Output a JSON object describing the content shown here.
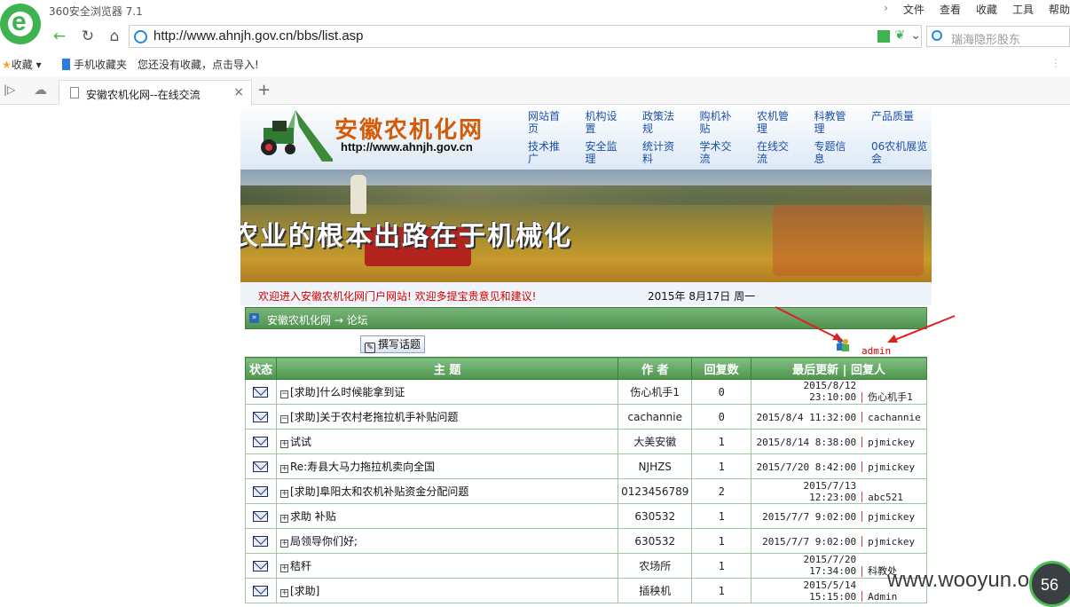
{
  "browser": {
    "app_title": "360安全浏览器 7.1",
    "menus": [
      "文件",
      "查看",
      "收藏",
      "工具",
      "帮助"
    ],
    "url": "http://www.ahnjh.gov.cn/bbs/list.asp",
    "search_placeholder": "瑞海隐形股东",
    "bookmarks": {
      "favorites": "收藏",
      "mobile_favorites": "手机收藏夹",
      "import_hint": "您还没有收藏，点击导入!"
    },
    "tab_title": "安徽农机化网--在线交流"
  },
  "site": {
    "name": "安徽农机化网",
    "url": "http://www.ahnjh.gov.cn",
    "nav": [
      "网站首页",
      "机构设置",
      "政策法规",
      "购机补贴",
      "农机管理",
      "科教管理",
      "产品质量",
      "技术推广",
      "安全监理",
      "统计资料",
      "学术交流",
      "在线交流",
      "专题信息",
      "06农机展览会"
    ],
    "slogan": "农业的根本出路在于机械化",
    "welcome": "欢迎进入安徽农机化网门户网站! 欢迎多提宝贵意见和建议!",
    "date": "2015年  8月17日  周一",
    "breadcrumb": "安徽农机化网 → 论坛",
    "compose_label": "撰写话题",
    "user": "admin"
  },
  "forum": {
    "headers": {
      "status": "状态",
      "topic": "主  题",
      "author": "作 者",
      "replies": "回复数",
      "last": "最后更新 | 回复人"
    },
    "rows": [
      {
        "expand": "−",
        "topic": "[求助]什么时候能拿到证",
        "author": "伤心机手1",
        "replies": "0",
        "last_time": "2015/8/12 23:10:00",
        "last_user": "伤心机手1"
      },
      {
        "expand": "−",
        "topic": "[求助]关于农村老拖拉机手补贴问题",
        "author": "cachannie",
        "replies": "0",
        "last_time": "2015/8/4 11:32:00",
        "last_user": "cachannie"
      },
      {
        "expand": "+",
        "topic": "试试",
        "author": "大美安徽",
        "replies": "1",
        "last_time": "2015/8/14 8:38:00",
        "last_user": "pjmickey"
      },
      {
        "expand": "+",
        "topic": "Re:寿县大马力拖拉机卖向全国",
        "author": "NJHZS",
        "replies": "1",
        "last_time": "2015/7/20 8:42:00",
        "last_user": "pjmickey"
      },
      {
        "expand": "+",
        "topic": "[求助]阜阳太和农机补贴资金分配问题",
        "author": "0123456789",
        "replies": "2",
        "last_time": "2015/7/13 12:23:00",
        "last_user": "abc521"
      },
      {
        "expand": "+",
        "topic": "求助 补贴",
        "author": "630532",
        "replies": "1",
        "last_time": "2015/7/7 9:02:00",
        "last_user": "pjmickey"
      },
      {
        "expand": "+",
        "topic": "局领导你们好;",
        "author": "630532",
        "replies": "1",
        "last_time": "2015/7/7 9:02:00",
        "last_user": "pjmickey"
      },
      {
        "expand": "+",
        "topic": "秸秆",
        "author": "农场所",
        "replies": "1",
        "last_time": "2015/7/20 17:34:00",
        "last_user": "科教处"
      },
      {
        "expand": "+",
        "topic": "[求助]",
        "author": "插秧机",
        "replies": "1",
        "last_time": "2015/5/14 15:15:00",
        "last_user": "Admin"
      }
    ]
  },
  "overlay": {
    "watermark": "www.wooyun.org",
    "speed": "56"
  },
  "colors": {
    "accent_green": "#4f934e",
    "link_blue": "#1a4fa8",
    "alert_red": "#d40000",
    "brand_orange": "#d35b07"
  }
}
